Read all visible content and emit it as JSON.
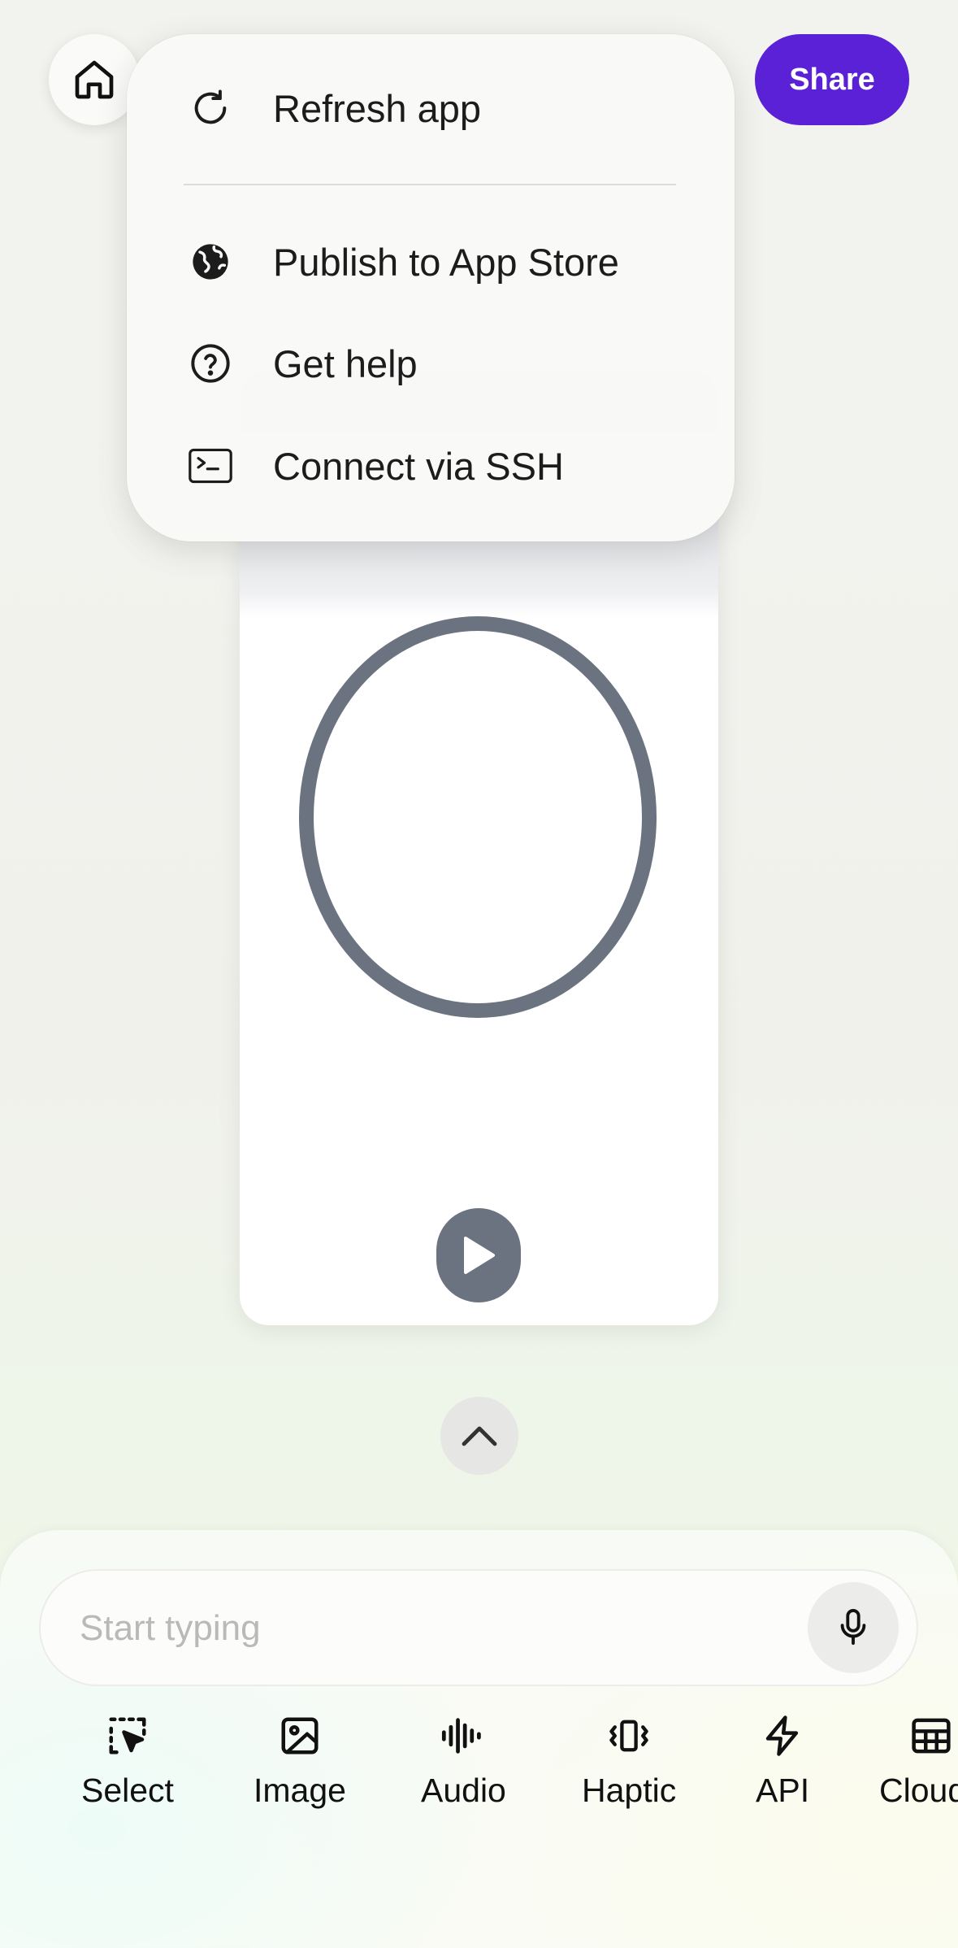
{
  "header": {
    "home_icon": "home-icon",
    "share_label": "Share",
    "share_color": "#5b21d6"
  },
  "menu": {
    "items": [
      {
        "label": "Refresh app",
        "icon": "refresh-icon"
      },
      {
        "label": "Publish to App Store",
        "icon": "globe-icon"
      },
      {
        "label": "Get help",
        "icon": "help-circle-icon"
      },
      {
        "label": "Connect via SSH",
        "icon": "terminal-icon"
      }
    ]
  },
  "preview": {
    "ring_color": "#6b7280",
    "play_icon": "play-icon"
  },
  "composer": {
    "placeholder": "Start typing",
    "value": "",
    "mic_icon": "microphone-icon",
    "tools": [
      {
        "label": "Select",
        "icon": "select-cursor-icon"
      },
      {
        "label": "Image",
        "icon": "image-icon"
      },
      {
        "label": "Audio",
        "icon": "audio-waveform-icon"
      },
      {
        "label": "Haptic",
        "icon": "haptic-vibrate-icon"
      },
      {
        "label": "API",
        "icon": "lightning-icon"
      },
      {
        "label": "Cloud",
        "icon": "table-grid-icon"
      }
    ]
  }
}
